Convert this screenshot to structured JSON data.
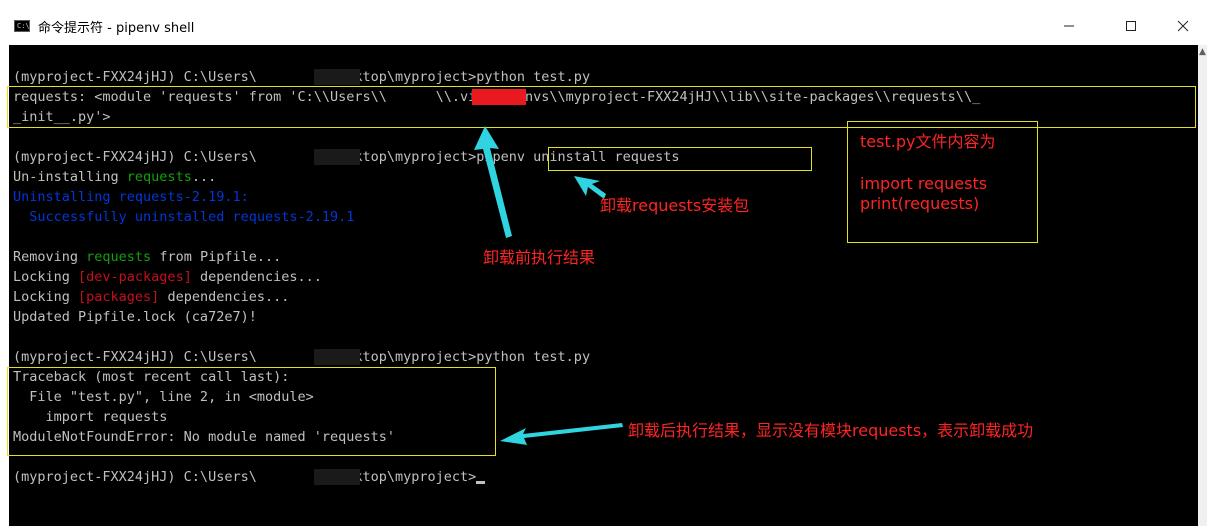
{
  "window": {
    "title": "命令提示符 - pipenv  shell",
    "icon_text": "C:\\"
  },
  "console_lines": [
    "(myproject-FXX24jHJ) C:\\Users\\        \\Desktop\\myproject>python test.py",
    "requests: <module 'requests' from 'C:\\\\Users\\\\      \\\\.virtualenvs\\\\myproject-FXX24jHJ\\\\lib\\\\site-packages\\\\requests\\\\_",
    "_init__.py'>",
    "(myproject-FXX24jHJ) C:\\Users\\        \\Desktop\\myproject>pipenv uninstall requests",
    "Un-installing ",
    "requests",
    "...",
    "Uninstalling requests-2.19.1:",
    "  Successfully uninstalled requests-2.19.1",
    "Removing ",
    "requests",
    " from Pipfile...",
    "Locking ",
    "[dev-packages]",
    " dependencies...",
    "Locking ",
    "[packages]",
    " dependencies...",
    "Updated Pipfile.lock (ca72e7)!",
    "(myproject-FXX24jHJ) C:\\Users\\        \\Desktop\\myproject>python test.py",
    "Traceback (most recent call last):",
    "  File \"test.py\", line 2, in <module>",
    "    import requests",
    "ModuleNotFoundError: No module named 'requests'",
    "(myproject-FXX24jHJ) C:\\Users\\        \\Desktop\\myproject>"
  ],
  "annotations": {
    "before_result": "卸载前执行结果",
    "uninstall_pkg": "卸载requests安装包",
    "after_result": "卸载后执行结果，显示没有模块requests，表示卸载成功",
    "note_title": "test.py文件内容为",
    "note_line1": "import requests",
    "note_line2": "print(requests)"
  },
  "colors": {
    "console_bg": "#000000",
    "console_text": "#c0c0c0",
    "green": "#13a10e",
    "red": "#c50f1f",
    "blue": "#0037da",
    "annotation_red": "#ff2424",
    "highlight_yellow": "#e5e01a",
    "arrow_cyan": "#2fd4e0"
  }
}
